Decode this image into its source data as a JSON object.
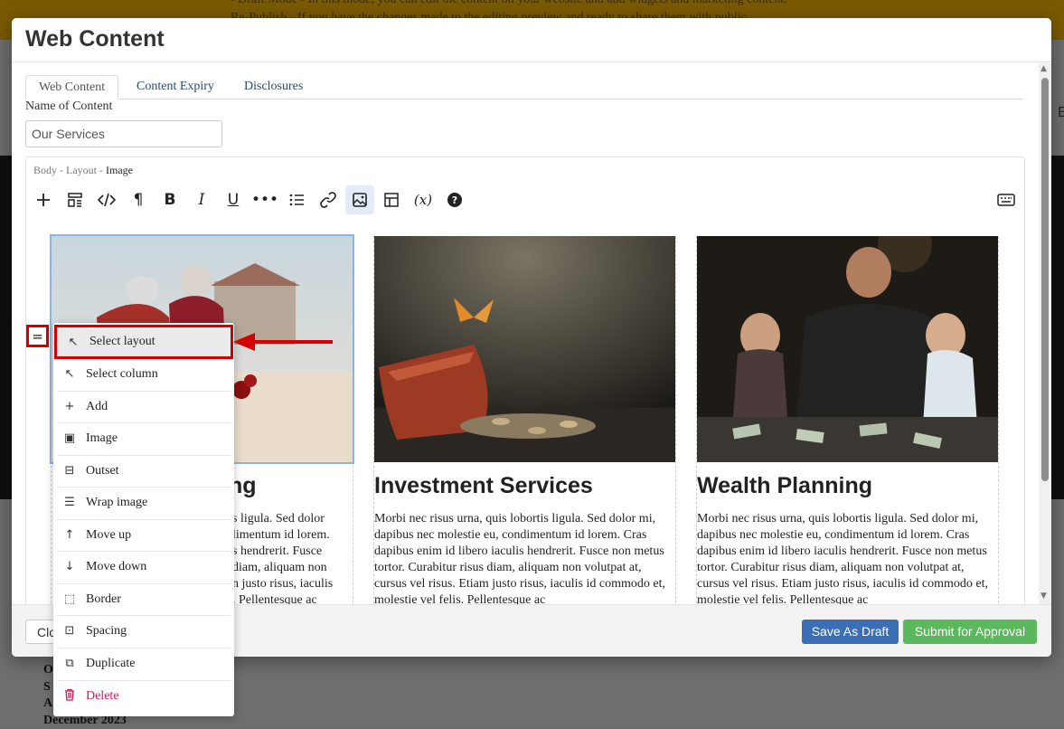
{
  "background": {
    "banner_text_1": "- Draft Mode - In this mode, you can edit the content on your website and add widgets and marketing content.",
    "banner_text_2": "Re-Publish - If you have the changes made to the editing preview and ready to share them with public...",
    "footer_lines": [
      "O",
      "S",
      "A",
      "December 2023"
    ],
    "edge_letter": "E"
  },
  "modal": {
    "title": "Web Content",
    "tabs": [
      {
        "label": "Web Content",
        "active": true
      },
      {
        "label": "Content Expiry",
        "active": false
      },
      {
        "label": "Disclosures",
        "active": false
      }
    ],
    "name_label": "Name of Content",
    "name_value": "Our Services"
  },
  "editor": {
    "breadcrumb": [
      "Body -",
      "Layout -",
      "Image"
    ],
    "toolbar_icons": [
      "plus-icon",
      "layout-icon",
      "code-icon",
      "paragraph-icon",
      "bold-icon",
      "italic-icon",
      "underline-icon",
      "more-icon",
      "list-icon",
      "link-icon",
      "image-icon",
      "table-icon",
      "variable-icon",
      "help-icon",
      "keyboard-icon"
    ],
    "columns": [
      {
        "title": "Estate Planning",
        "title_visible": "ng",
        "text": "Morbi nec risus urna, quis lobortis ligula. Sed dolor mi, dapibus nec molestie eu, condimentum id lorem. Cras dapibus enim id libero iaculis hendrerit. Fusce non metus tortor. Curabitur risus diam, aliquam non volutpat at, cursus vel risus. Etiam justo risus, iaculis id commodo et, molestie vel felis. Pellentesque ac"
      },
      {
        "title": "Investment Services",
        "text": "Morbi nec risus urna, quis lobortis ligula. Sed dolor mi, dapibus nec molestie eu, condimentum id lorem. Cras dapibus enim id libero iaculis hendrerit. Fusce non metus tortor. Curabitur risus diam, aliquam non volutpat at, cursus vel risus. Etiam justo risus, iaculis id commodo et, molestie vel felis. Pellentesque ac"
      },
      {
        "title": "Wealth Planning",
        "text": "Morbi nec risus urna, quis lobortis ligula. Sed dolor mi, dapibus nec molestie eu, condimentum id lorem. Cras dapibus enim id libero iaculis hendrerit. Fusce non metus tortor. Curabitur risus diam, aliquam non volutpat at, cursus vel risus. Etiam justo risus, iaculis id commodo et, molestie vel felis. Pellentesque ac"
      }
    ],
    "col1_visible_text": "s ligula. Sed dolor\nlimentum id lorem.\ns hendrerit. Fusce\ndiam, aliquam non\nn justo risus, iaculis\n. Pellentesque ac"
  },
  "handle_glyph": "=",
  "context_menu": {
    "items": [
      {
        "label": "Select layout",
        "icon": "arrow-up-left-icon",
        "glyph": "↖",
        "highlighted": true
      },
      {
        "label": "Select column",
        "icon": "arrow-up-left-icon",
        "glyph": "↖"
      },
      {
        "label": "Add",
        "icon": "plus-icon",
        "glyph": "+"
      },
      {
        "label": "Image",
        "icon": "image-icon",
        "glyph": "▣"
      },
      {
        "label": "Outset",
        "icon": "outset-icon",
        "glyph": "⊟"
      },
      {
        "label": "Wrap image",
        "icon": "wrap-image-icon",
        "glyph": "☰"
      },
      {
        "label": "Move up",
        "icon": "arrow-up-icon",
        "glyph": "↑"
      },
      {
        "label": "Move down",
        "icon": "arrow-down-icon",
        "glyph": "↓"
      },
      {
        "label": "Border",
        "icon": "border-icon",
        "glyph": "⬚"
      },
      {
        "label": "Spacing",
        "icon": "spacing-icon",
        "glyph": "⊡"
      },
      {
        "label": "Duplicate",
        "icon": "duplicate-icon",
        "glyph": "⧉"
      },
      {
        "label": "Delete",
        "icon": "trash-icon",
        "glyph": "🗑",
        "danger": true
      }
    ]
  },
  "footer": {
    "close_label": "Close",
    "draft_label": "Save As Draft",
    "submit_label": "Submit for Approval"
  },
  "colors": {
    "accent_blue": "#3a6fb5",
    "submit_green": "#5cb85c",
    "annotation_red": "#d40000",
    "delete_pink": "#d4145a"
  }
}
